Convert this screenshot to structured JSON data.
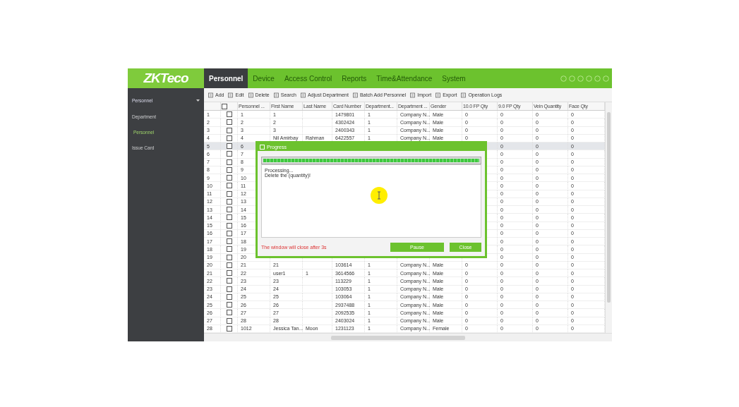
{
  "logo": {
    "text": "ZKTeco"
  },
  "nav_tabs": [
    {
      "label": "Personnel",
      "selected": true
    },
    {
      "label": "Device",
      "selected": false
    },
    {
      "label": "Access Control",
      "selected": false
    },
    {
      "label": "Reports",
      "selected": false
    },
    {
      "label": "Time&Attendance",
      "selected": false
    },
    {
      "label": "System",
      "selected": false
    }
  ],
  "sidebar": {
    "group": {
      "label": "Personnel",
      "expanded": true
    },
    "items": [
      {
        "label": "Department",
        "selected": false
      },
      {
        "label": "Personnel",
        "selected": true
      },
      {
        "label": "Issue Card",
        "selected": false
      }
    ]
  },
  "toolbar": [
    "Add",
    "Edit",
    "Delete",
    "Search",
    "Adjust Department",
    "Batch Add Personnel",
    "Import",
    "Export",
    "Operation Logs"
  ],
  "table": {
    "columns": [
      "Personnel ...",
      "First Name",
      "Last Name",
      "Card Number",
      "Department...",
      "Department ...",
      "Gender",
      "10.0 FP Qty",
      "9.0 FP Qty",
      "Vein Quantity",
      "Face Qty"
    ],
    "rows": [
      {
        "no": "1",
        "checked": false,
        "selected": false,
        "cells": [
          "1",
          "1",
          null,
          "1479801",
          "1",
          "Company N...",
          "Male",
          "0",
          "0",
          "0",
          "0"
        ]
      },
      {
        "no": "2",
        "checked": false,
        "selected": false,
        "cells": [
          "2",
          "2",
          null,
          "4302424",
          "1",
          "Company N...",
          "Male",
          "0",
          "0",
          "0",
          "0"
        ]
      },
      {
        "no": "3",
        "checked": false,
        "selected": false,
        "cells": [
          "3",
          "3",
          null,
          "2400343",
          "1",
          "Company N...",
          "Male",
          "0",
          "0",
          "0",
          "0"
        ]
      },
      {
        "no": "4",
        "checked": false,
        "selected": false,
        "cells": [
          "4",
          "Nil Amirbay",
          "Rahman",
          "6422557",
          "1",
          "Company N...",
          "Male",
          "0",
          "0",
          "0",
          "0"
        ]
      },
      {
        "no": "5",
        "checked": false,
        "selected": true,
        "cells": [
          "6",
          null,
          null,
          null,
          null,
          null,
          null,
          null,
          "0",
          "0",
          "0"
        ]
      },
      {
        "no": "6",
        "checked": false,
        "selected": false,
        "cells": [
          "7",
          null,
          null,
          null,
          null,
          null,
          null,
          null,
          "0",
          "0",
          "0"
        ]
      },
      {
        "no": "7",
        "checked": false,
        "selected": false,
        "cells": [
          "8",
          null,
          null,
          null,
          null,
          null,
          null,
          null,
          "0",
          "0",
          "0"
        ]
      },
      {
        "no": "8",
        "checked": false,
        "selected": false,
        "cells": [
          "9",
          null,
          null,
          null,
          null,
          null,
          null,
          null,
          "0",
          "0",
          "0"
        ]
      },
      {
        "no": "9",
        "checked": false,
        "selected": false,
        "cells": [
          "10",
          null,
          null,
          null,
          null,
          null,
          null,
          null,
          "0",
          "0",
          "0"
        ]
      },
      {
        "no": "10",
        "checked": false,
        "selected": false,
        "cells": [
          "11",
          null,
          null,
          null,
          null,
          null,
          null,
          null,
          "0",
          "0",
          "0"
        ]
      },
      {
        "no": "11",
        "checked": false,
        "selected": false,
        "cells": [
          "12",
          null,
          null,
          null,
          null,
          null,
          null,
          null,
          "0",
          "0",
          "0"
        ]
      },
      {
        "no": "12",
        "checked": false,
        "selected": false,
        "cells": [
          "13",
          null,
          null,
          null,
          null,
          null,
          null,
          null,
          "0",
          "0",
          "0"
        ]
      },
      {
        "no": "13",
        "checked": false,
        "selected": false,
        "cells": [
          "14",
          null,
          null,
          null,
          null,
          null,
          null,
          null,
          "0",
          "0",
          "0"
        ]
      },
      {
        "no": "14",
        "checked": false,
        "selected": false,
        "cells": [
          "15",
          null,
          null,
          null,
          null,
          null,
          null,
          null,
          "0",
          "0",
          "0"
        ]
      },
      {
        "no": "15",
        "checked": false,
        "selected": false,
        "cells": [
          "16",
          null,
          null,
          null,
          null,
          null,
          null,
          null,
          "0",
          "0",
          "0"
        ]
      },
      {
        "no": "16",
        "checked": false,
        "selected": false,
        "cells": [
          "17",
          null,
          null,
          null,
          null,
          null,
          null,
          null,
          "0",
          "0",
          "0"
        ]
      },
      {
        "no": "17",
        "checked": false,
        "selected": false,
        "cells": [
          "18",
          null,
          null,
          null,
          null,
          null,
          null,
          null,
          "0",
          "0",
          "0"
        ]
      },
      {
        "no": "18",
        "checked": false,
        "selected": false,
        "cells": [
          "19",
          null,
          null,
          null,
          null,
          null,
          null,
          null,
          "0",
          "0",
          "0"
        ]
      },
      {
        "no": "19",
        "checked": false,
        "selected": false,
        "cells": [
          "20",
          null,
          null,
          null,
          null,
          null,
          null,
          null,
          "0",
          "0",
          "0"
        ]
      },
      {
        "no": "20",
        "checked": false,
        "selected": false,
        "cells": [
          "21",
          "21",
          null,
          "103614",
          "1",
          "Company N...",
          "Male",
          "0",
          "0",
          "0",
          "0"
        ]
      },
      {
        "no": "21",
        "checked": false,
        "selected": false,
        "cells": [
          "22",
          "user1",
          "1",
          "3614566",
          "1",
          "Company N...",
          "Male",
          "0",
          "0",
          "0",
          "0"
        ]
      },
      {
        "no": "22",
        "checked": false,
        "selected": false,
        "cells": [
          "23",
          "23",
          null,
          "113229",
          "1",
          "Company N...",
          "Male",
          "0",
          "0",
          "0",
          "0"
        ]
      },
      {
        "no": "23",
        "checked": false,
        "selected": false,
        "cells": [
          "24",
          "24",
          null,
          "103053",
          "1",
          "Company N...",
          "Male",
          "0",
          "0",
          "0",
          "0"
        ]
      },
      {
        "no": "24",
        "checked": false,
        "selected": false,
        "cells": [
          "25",
          "25",
          null,
          "103064",
          "1",
          "Company N...",
          "Male",
          "0",
          "0",
          "0",
          "0"
        ]
      },
      {
        "no": "25",
        "checked": false,
        "selected": false,
        "cells": [
          "26",
          "26",
          null,
          "2937488",
          "1",
          "Company N...",
          "Male",
          "0",
          "0",
          "0",
          "0"
        ]
      },
      {
        "no": "26",
        "checked": false,
        "selected": false,
        "cells": [
          "27",
          "27",
          null,
          "2092535",
          "1",
          "Company N...",
          "Male",
          "0",
          "0",
          "0",
          "0"
        ]
      },
      {
        "no": "27",
        "checked": false,
        "selected": false,
        "cells": [
          "28",
          "28",
          null,
          "2403024",
          "1",
          "Company N...",
          "Male",
          "0",
          "0",
          "0",
          "0"
        ]
      },
      {
        "no": "28",
        "checked": false,
        "selected": false,
        "cells": [
          "1012",
          "Jessica Tan...",
          "Moon",
          "1231123",
          "1",
          "Company N...",
          "Female",
          "0",
          "0",
          "0",
          "0"
        ]
      }
    ]
  },
  "dialog": {
    "title": "Progress",
    "progress": {
      "level": 1
    },
    "log": [
      "Processing...",
      "Delete the (quantity)!"
    ],
    "countdown": "The window will close after 3s",
    "buttons": [
      "Pause",
      "Close"
    ]
  }
}
